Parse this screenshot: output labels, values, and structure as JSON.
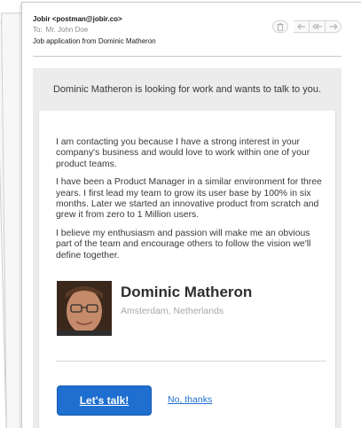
{
  "header": {
    "from": "Jobir <postman@jobir.co>",
    "to_label": "To:",
    "to_value": "Mr. John Doe",
    "subject": "Job application from Dominic Matheron"
  },
  "toolbar": {
    "icons": [
      "trash-icon",
      "reply-icon",
      "reply-all-icon",
      "forward-icon"
    ]
  },
  "tagline": "Dominic Matheron is looking for work and wants to talk to you.",
  "message": {
    "paragraphs": [
      "I am contacting you because I have a strong interest in your company's business and would love to work within one of your product teams.",
      "I have been a Product Manager in a similar environment for three years. I first lead my team to grow its user base by 100% in six months. Later we started an innovative product from scratch and grew it from zero to 1 Million users.",
      "I believe my enthusiasm and passion will make me an obvious part of the team and encourage others to follow the vision we'll define together."
    ]
  },
  "profile": {
    "name": "Dominic Matheron",
    "location": "Amsterdam, Netherlands"
  },
  "actions": {
    "primary_label": "Let's talk!",
    "secondary_label": "No, thanks"
  },
  "colors": {
    "accent": "#1e6fcf",
    "band": "#ececec"
  }
}
